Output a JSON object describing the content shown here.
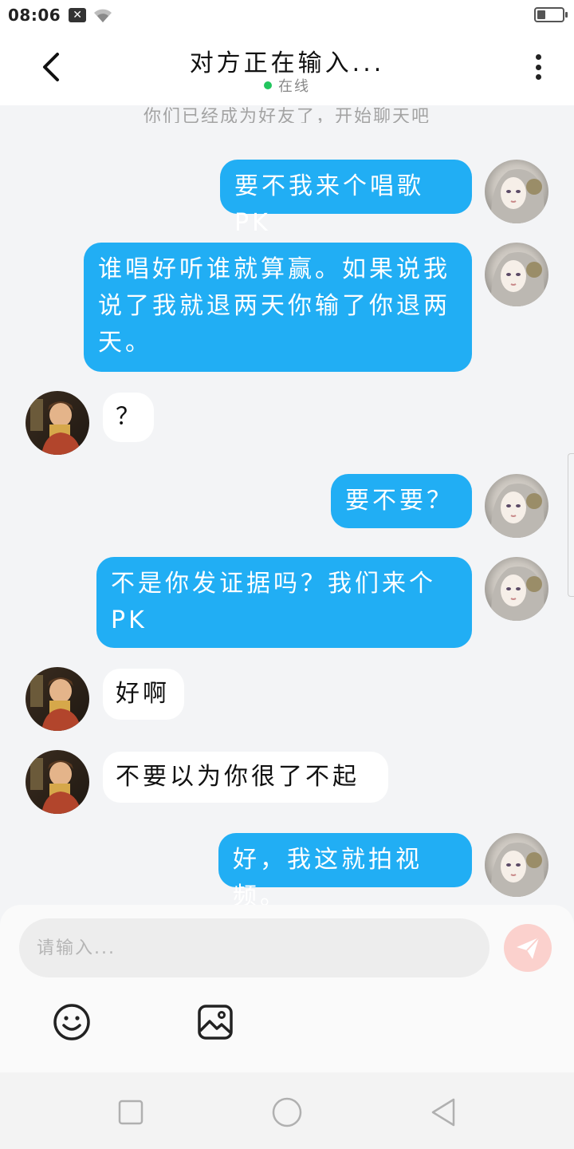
{
  "status_bar": {
    "time": "08:06",
    "notification_icon": "x-notification-icon",
    "wifi_icon": "wifi-icon",
    "battery_icon": "battery-icon"
  },
  "header": {
    "title": "对方正在输入...",
    "status": "在线",
    "back_icon": "chevron-left-icon",
    "more_icon": "more-vertical-icon"
  },
  "system_note": "你们已经成为好友了，开始聊天吧",
  "messages": [
    {
      "side": "me",
      "text": "要不我来个唱歌PK"
    },
    {
      "side": "me",
      "text": "谁唱好听谁就算赢。如果说我说了我就退两天你输了你退两天。"
    },
    {
      "side": "other",
      "text": "？"
    },
    {
      "side": "me",
      "text": "要不要？"
    },
    {
      "side": "me",
      "text": "不是你发证据吗？我们来个PK"
    },
    {
      "side": "other",
      "text": "好啊"
    },
    {
      "side": "other",
      "text": "不要以为你很了不起"
    },
    {
      "side": "me",
      "text": "好，我这就拍视频。"
    }
  ],
  "input": {
    "placeholder": "请输入...",
    "value": ""
  },
  "toolbar": {
    "send_icon": "send-icon",
    "emoji_icon": "emoji-icon",
    "image_icon": "image-icon"
  },
  "nav": {
    "recent_icon": "square-icon",
    "home_icon": "circle-icon",
    "back_icon": "triangle-back-icon"
  },
  "colors": {
    "my_bubble": "#21aef4",
    "other_bubble": "#ffffff",
    "background": "#f3f4f6",
    "online": "#22c55e",
    "send_button": "#fbd1cd"
  }
}
